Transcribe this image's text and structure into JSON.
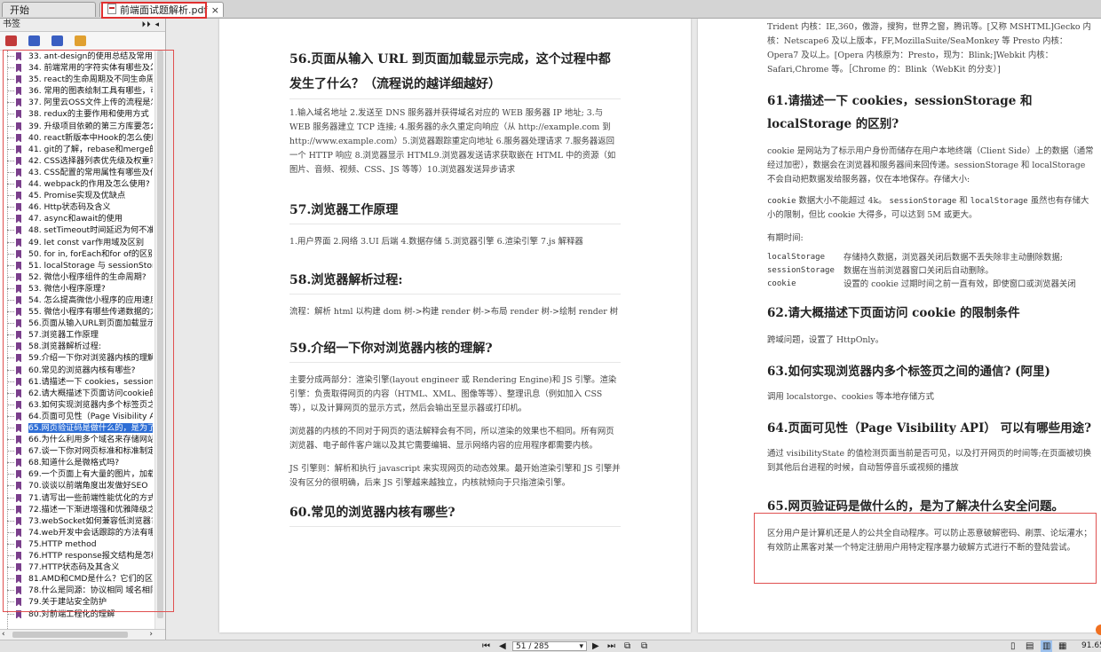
{
  "tabs": [
    {
      "label": "开始"
    },
    {
      "label": "前端面试题解析.pdf",
      "close": "×"
    }
  ],
  "sidebar": {
    "title": "书签",
    "controls": "⏵⏵ ◂",
    "bookmarks": [
      "33. ant-design的使用总结及常用组件",
      "34. 前端常用的字符实体有哪些及怎么用",
      "35. react的生命周期及不同生命周期的作用",
      "36. 常用的图表绘制工具有哪些，可以说一下",
      "37. 阿里云OSS文件上传的流程是怎样的",
      "38. redux的主要作用和使用方式",
      "39. 升级项目依赖的第三方库要怎么做",
      "40. react新版本中Hook的怎么使用",
      "41. git的了解，rebase和merge的区别",
      "42. CSS选择器列表优先级及权重?",
      "43. CSS配置的常用属性有哪些及作用",
      "44. webpack的作用及怎么使用?",
      "45. Promise实现及优缺点",
      "46. Http状态码及含义",
      "47. async和await的使用",
      "48. setTimeout时间延迟为何不准",
      "49. let const var作用域及区别",
      "50. for in, forEach和for of的区别",
      "51. localStorage 与 sessionStorage 与 cookie",
      "52. 微信小程序组件的生命周期?",
      "53. 微信小程序原理?",
      "54. 怎么提高微信小程序的应用速度",
      "55. 微信小程序有哪些传递数据的方法",
      "56.页面从输入URL到页面加载显示完成",
      "57.浏览器工作原理",
      "58.浏览器解析过程:",
      "59.介绍一下你对浏览器内核的理解?",
      "60.常见的浏览器内核有哪些?",
      "61.请描述一下 cookies，sessionStorage",
      "62.请大概描述下页面访问cookie的限制",
      "63.如何实现浏览器内多个标签页之间的通信",
      "64.页面可见性（Page Visibility API）",
      "65.网页验证码是做什么的，是为了解决",
      "66.为什么利用多个域名来存储网站资源",
      "67.谈一下你对网页标准和标准制定机构",
      "68.知道什么是微格式吗?",
      "69.一个页面上有大量的图片，加载很慢",
      "70.谈谈以前端角度出发做好SEO（搜索",
      "71.请写出一些前端性能优化的方式，越多越好",
      "72.描述一下渐进增强和优雅降级之间的不同",
      "73.webSocket如何兼容低浏览器?（阿里）",
      "74.web开发中会话跟踪的方法有哪些",
      "75.HTTP method",
      "76.HTTP response报文结构是怎样的",
      "77.HTTP状态码及其含义",
      "81.AMD和CMD是什么？它们的区别",
      "78.什么是同源：协议相同 域名相同",
      "79.关于建站安全防护",
      "80.对前端工程化的理解"
    ],
    "selected_index": 32
  },
  "left_page": {
    "s56": {
      "title": "56.页面从输入 URL 到页面加载显示完成，这个过程中都发生了什么？（流程说的越详细越好）",
      "body": "1.输入域名地址 2.发送至 DNS 服务器并获得域名对应的 WEB 服务器 IP 地址; 3.与 WEB 服务器建立 TCP 连接; 4.服务器的永久重定向响应（从 http://example.com 到 http://www.example.com）5.浏览器跟踪重定向地址 6.服务器处理请求 7.服务器返回一个 HTTP 响应 8.浏览器显示 HTML9.浏览器发送请求获取嵌在 HTML 中的资源（如图片、音频、视频、CSS、JS 等等）10.浏览器发送异步请求"
    },
    "s57": {
      "title": "57.浏览器工作原理",
      "body": "1.用户界面 2.网络 3.UI 后端 4.数据存储 5.浏览器引擎 6.渲染引擎 7.js 解释器"
    },
    "s58": {
      "title": "58.浏览器解析过程:",
      "body": "流程：解析 html 以构建 dom 树->构建 render 树->布局 render 树->绘制 render 树"
    },
    "s59": {
      "title": "59.介绍一下你对浏览器内核的理解?",
      "body1": "主要分成两部分：渲染引擎(layout engineer 或 Rendering Engine)和 JS 引擎。渲染引擎：负责取得网页的内容（HTML、XML、图像等等）、整理讯息（例如加入 CSS 等），以及计算网页的显示方式，然后会输出至显示器或打印机。",
      "body2": "浏览器的内核的不同对于网页的语法解释会有不同，所以渲染的效果也不相同。所有网页浏览器、电子邮件客户端以及其它需要编辑、显示网络内容的应用程序都需要内核。",
      "body3": "JS 引擎则：解析和执行 javascript 来实现网页的动态效果。最开始渲染引擎和 JS 引擎并没有区分的很明确，后来 JS 引擎越来越独立，内核就倾向于只指渲染引擎。"
    },
    "s60": {
      "title": "60.常见的浏览器内核有哪些?"
    }
  },
  "right_page": {
    "top_text": "Trident 内核：IE,360，傲游，搜狗，世界之窗，腾讯等。[又称 MSHTML]Gecko 内核：Netscape6 及以上版本，FF,MozillaSuite/SeaMonkey 等 Presto 内核：Opera7 及以上。[Opera 内核原为：Presto，现为：Blink;]Webkit 内核：Safari,Chrome 等。［Chrome 的：Blink（WebKit 的分支）]",
    "s61": {
      "title": "61.请描述一下 cookies，sessionStorage 和 localStorage 的区别?",
      "body1": "cookie 是网站为了标示用户身份而储存在用户本地终端（Client Side）上的数据（通常经过加密），数据会在浏览器和服务器间来回传递。sessionStorage 和 localStorage 不会自动把数据发给服务器，仅在本地保存。存储大小:",
      "body2_code1": "cookie",
      "body2_text1": " 数据大小不能超过 4k。 ",
      "body2_code2": "sessionStorage",
      "body2_text2": " 和 ",
      "body2_code3": "localStorage",
      "body2_text3": " 虽然也有存储大小的限制，但比 cookie 大得多，可以达到 5M 或更大。",
      "expiry_label": "有期时间:",
      "expiry_rows": [
        {
          "key": "localStorage",
          "desc": "存储持久数据，浏览器关闭后数据不丢失除非主动删除数据;"
        },
        {
          "key": "sessionStorage",
          "desc": "数据在当前浏览器窗口关闭后自动删除。"
        },
        {
          "key": "cookie",
          "desc": "设置的 cookie 过期时间之前一直有效，即使窗口或浏览器关闭"
        }
      ]
    },
    "s62": {
      "title": "62.请大概描述下页面访问 cookie 的限制条件",
      "body": "跨域问题，设置了 HttpOnly。"
    },
    "s63": {
      "title": "63.如何实现浏览器内多个标签页之间的通信? (阿里)",
      "body": "调用 localstorge、cookies 等本地存储方式"
    },
    "s64": {
      "title": "64.页面可见性（Page Visibility API） 可以有哪些用途?",
      "body": "通过 visibilityState 的值检测页面当前是否可见，以及打开网页的时间等;在页面被切换到其他后台进程的时候，自动暂停音乐或视频的播放"
    },
    "s65": {
      "title": "65.网页验证码是做什么的，是为了解决什么安全问题。",
      "body": "区分用户是计算机还是人的公共全自动程序。可以防止恶意破解密码、刷票、论坛灌水；有效防止黑客对某一个特定注册用户用特定程序暴力破解方式进行不断的登陆尝试。"
    }
  },
  "statusbar": {
    "page_value": "51 / 285",
    "zoom": "91.65"
  }
}
